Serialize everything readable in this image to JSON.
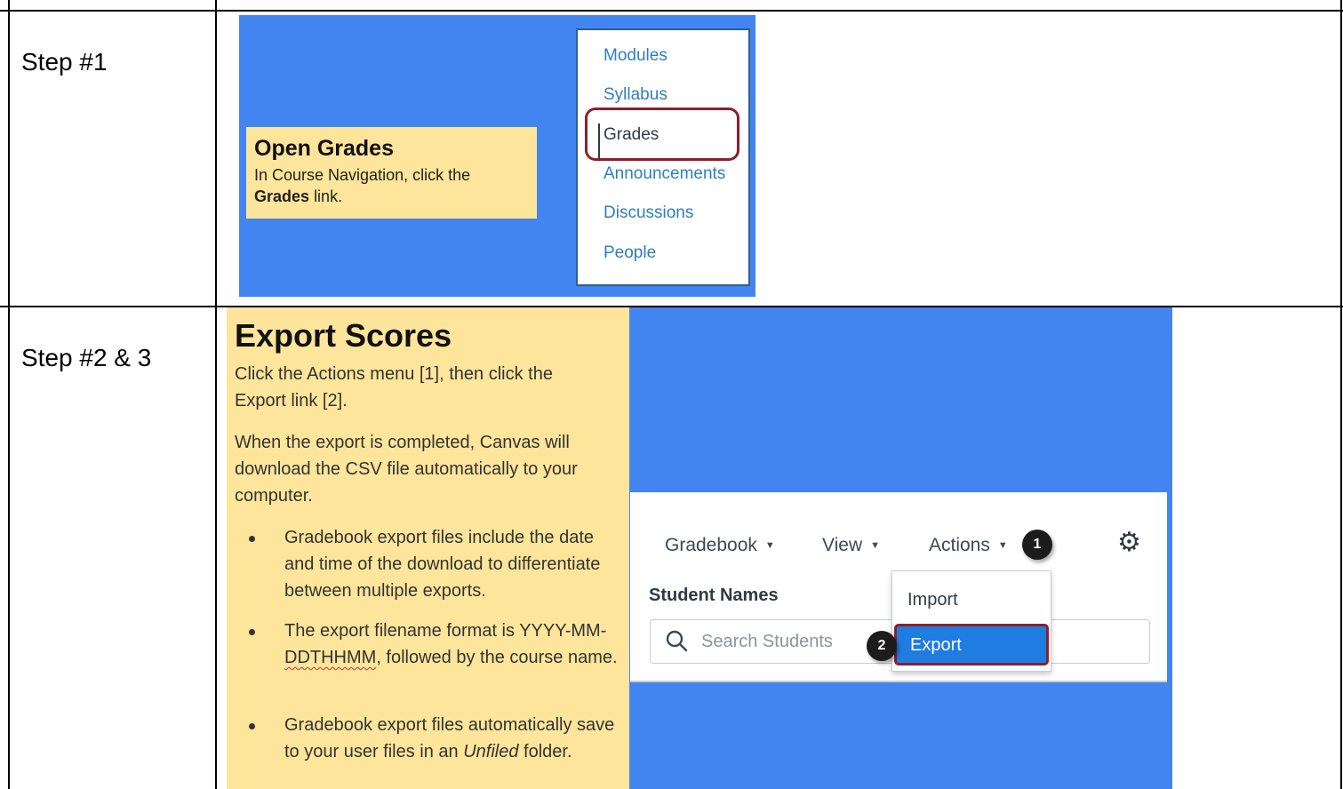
{
  "rows": [
    {
      "label": "Step #1"
    },
    {
      "label": "Step #2 & 3"
    }
  ],
  "step1": {
    "callout": {
      "title": "Open Grades",
      "text_before": "In Course Navigation, click the",
      "text_bold": "Grades",
      "text_after": "link."
    },
    "nav_items": [
      {
        "label": "Modules",
        "active": false
      },
      {
        "label": "Syllabus",
        "active": false
      },
      {
        "label": "Grades",
        "active": true
      },
      {
        "label": "Announcements",
        "active": false
      },
      {
        "label": "Discussions",
        "active": false
      },
      {
        "label": "People",
        "active": false
      }
    ]
  },
  "step2": {
    "title": "Export Scores",
    "para1": "Click the Actions menu [1], then click the Export link [2].",
    "para2": "When the export is completed, Canvas will download the CSV file automatically to your computer.",
    "bullet1": "Gradebook export files include the date and time of the download to differentiate between multiple exports.",
    "bullet2_before": "The export filename format is YYYY-MM-",
    "bullet2_code": "DDTHHMM",
    "bullet2_after": ", followed by the course name.",
    "bullet3_before": "Gradebook export files automatically save to your user files in an",
    "bullet3_italic": "Unfiled",
    "bullet3_after": "folder.",
    "gradebook": {
      "menu_gradebook": "Gradebook",
      "menu_view": "View",
      "menu_actions": "Actions",
      "badge1": "1",
      "badge2": "2",
      "student_names": "Student Names",
      "search_placeholder": "Search Students",
      "dropdown_import": "Import",
      "dropdown_export": "Export"
    }
  },
  "colors": {
    "blue_background": "#4285f0",
    "callout_yellow": "#fde59b",
    "highlight_red": "#8d1f2a",
    "link_blue": "#2d7fc0",
    "export_blue": "#1f7ce0"
  }
}
